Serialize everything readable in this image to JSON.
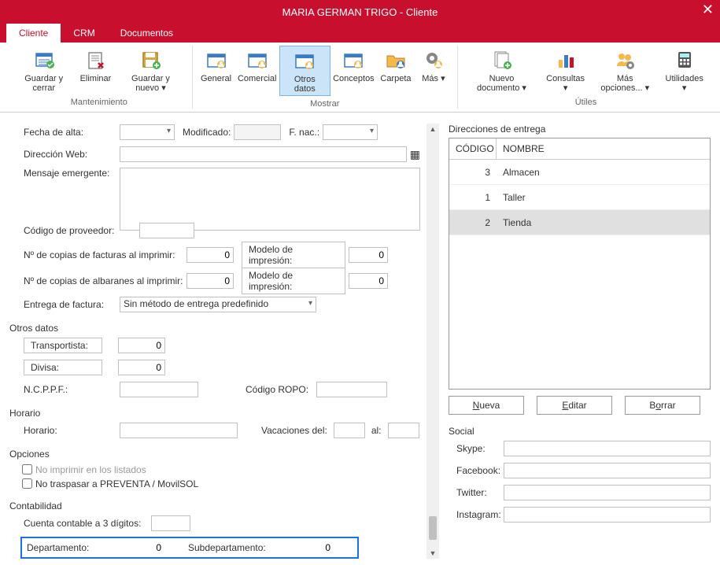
{
  "titlebar": {
    "title": "MARIA GERMAN TRIGO - Cliente"
  },
  "tabs": [
    {
      "label": "Cliente",
      "active": true
    },
    {
      "label": "CRM",
      "active": false
    },
    {
      "label": "Documentos",
      "active": false
    }
  ],
  "ribbon": {
    "groups": [
      {
        "title": "Mantenimiento",
        "items": [
          {
            "label": "Guardar y cerrar"
          },
          {
            "label": "Eliminar"
          },
          {
            "label": "Guardar y nuevo ▾"
          }
        ]
      },
      {
        "title": "Mostrar",
        "items": [
          {
            "label": "General"
          },
          {
            "label": "Comercial"
          },
          {
            "label": "Otros datos",
            "active": true
          },
          {
            "label": "Conceptos"
          },
          {
            "label": "Carpeta"
          },
          {
            "label": "Más ▾"
          }
        ]
      },
      {
        "title": "Útiles",
        "items": [
          {
            "label": "Nuevo documento ▾"
          },
          {
            "label": "Consultas ▾"
          },
          {
            "label": "Más opciones... ▾"
          },
          {
            "label": "Utilidades ▾"
          }
        ]
      }
    ]
  },
  "form": {
    "fecha_alta_label": "Fecha de alta:",
    "fecha_alta": "",
    "modificado_label": "Modificado:",
    "modificado": "",
    "fnac_label": "F. nac.:",
    "fnac": "",
    "direccion_web_label": "Dirección Web:",
    "direccion_web": "",
    "mensaje_label": "Mensaje emergente:",
    "mensaje": "",
    "cod_prov_label": "Código de proveedor:",
    "cod_prov": "",
    "copias_fact_label": "Nº de copias de facturas al imprimir:",
    "copias_fact": "0",
    "modelo_impr1_label": "Modelo de impresión:",
    "modelo_impr1": "0",
    "copias_alb_label": "Nº de copias de albaranes al imprimir:",
    "copias_alb": "0",
    "modelo_impr2_label": "Modelo de impresión:",
    "modelo_impr2": "0",
    "entrega_fact_label": "Entrega de factura:",
    "entrega_fact": "Sin método de entrega predefinido",
    "otros_datos_title": "Otros datos",
    "transportista_label": "Transportista:",
    "transportista": "0",
    "divisa_label": "Divisa:",
    "divisa": "0",
    "ncppf_label": "N.C.P.P.F.:",
    "ncppf": "",
    "codigo_ropo_label": "Código ROPO:",
    "codigo_ropo": "",
    "horario_title": "Horario",
    "horario_label": "Horario:",
    "horario": "",
    "vacaciones_label": "Vacaciones del:",
    "vacaciones_del": "",
    "al_label": "al:",
    "vacaciones_al": "",
    "opciones_title": "Opciones",
    "chk_no_imprimir_label": "No imprimir en los listados",
    "chk_no_traspasar_label": "No traspasar a PREVENTA / MovilSOL",
    "contabilidad_title": "Contabilidad",
    "cuenta_3dig_label": "Cuenta contable a 3 dígitos:",
    "cuenta_3dig": "",
    "departamento_label": "Departamento:",
    "departamento": "0",
    "subdepartamento_label": "Subdepartamento:",
    "subdepartamento": "0"
  },
  "delivery": {
    "title": "Direcciones de entrega",
    "cols": {
      "codigo": "CÓDIGO",
      "nombre": "NOMBRE"
    },
    "rows": [
      {
        "codigo": "3",
        "nombre": "Almacen",
        "selected": false
      },
      {
        "codigo": "1",
        "nombre": "Taller",
        "selected": false
      },
      {
        "codigo": "2",
        "nombre": "Tienda",
        "selected": true
      }
    ],
    "btn_nueva": "Nueva",
    "btn_editar": "Editar",
    "btn_borrar": "Borrar"
  },
  "social": {
    "title": "Social",
    "skype_label": "Skype:",
    "skype": "",
    "facebook_label": "Facebook:",
    "facebook": "",
    "twitter_label": "Twitter:",
    "twitter": "",
    "instagram_label": "Instagram:",
    "instagram": ""
  }
}
